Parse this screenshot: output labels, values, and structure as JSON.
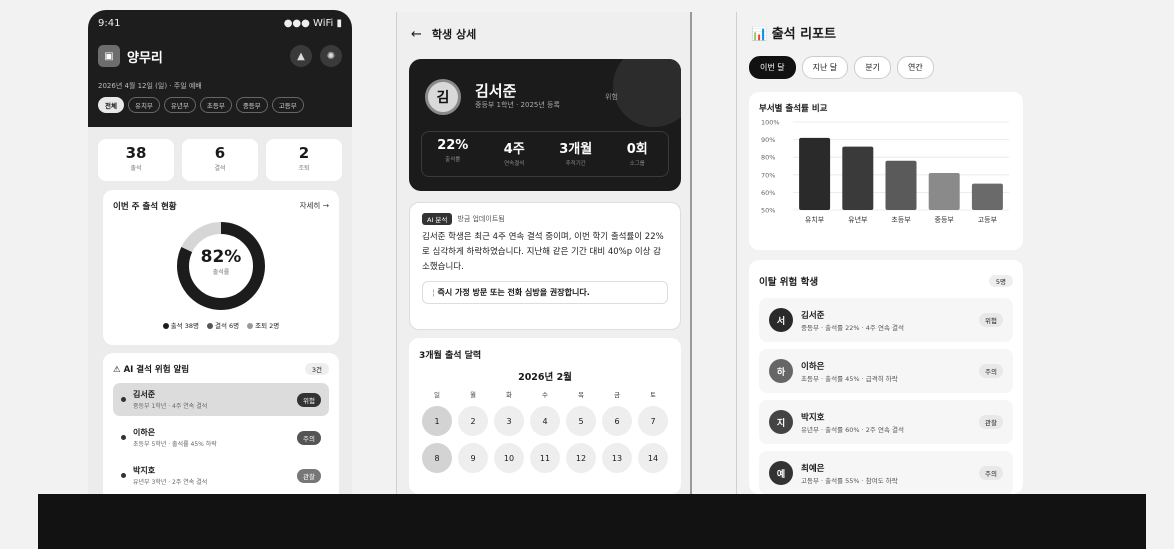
{
  "phone1": {
    "status": {
      "time": "9:41",
      "signal": "●●● WiFi ▮"
    },
    "app_name": "양무리",
    "date_line": "2026년 4월 12일 (일) · 주일 예배",
    "chips": [
      "전체",
      "유치부",
      "유년부",
      "초등부",
      "중등부",
      "고등부"
    ],
    "stats": [
      {
        "value": "38",
        "label": "출석"
      },
      {
        "value": "6",
        "label": "결석"
      },
      {
        "value": "2",
        "label": "조퇴"
      }
    ],
    "week": {
      "title": "이번 주 출석 현황",
      "more": "자세히 →",
      "percent": "82%",
      "percent_label": "출석률",
      "rate": 0.82,
      "legend": [
        "출석 38명",
        "결석 6명",
        "조퇴 2명"
      ]
    },
    "alerts": {
      "title": "⚠ AI 결석 위험 알림",
      "count": "3건",
      "items": [
        {
          "name": "김서준",
          "desc": "중등부 1학년 · 4주 연속 결석",
          "badge": "위험"
        },
        {
          "name": "이하은",
          "desc": "초등부 5학년 · 출석률 45% 하락",
          "badge": "주의"
        },
        {
          "name": "박지호",
          "desc": "유년부 3학년 · 2주 연속 결석",
          "badge": "관찰"
        }
      ]
    }
  },
  "phone2": {
    "back": "←",
    "title": "학생 상세",
    "profile": {
      "initial": "김",
      "name": "김서준",
      "sub": "중등부 1학년 · 2025년 등록",
      "risk": "위험",
      "stats": [
        {
          "value": "22%",
          "label": "출석률"
        },
        {
          "value": "4주",
          "label": "연속결석"
        },
        {
          "value": "3개월",
          "label": "추적기간"
        },
        {
          "value": "0회",
          "label": "소그룹"
        }
      ]
    },
    "ai": {
      "tag": "AI 분석",
      "updated": "방금 업데이트됨",
      "body": "김서준 학생은 최근 4주 연속 결석 중이며, 이번 학기 출석률이 22%로 심각하게 하락하였습니다. 지난해 같은 기간 대비 40%p 이상 감소했습니다.",
      "recommendation": "즉시 가정 방문 또는 전화 심방을 권장합니다."
    },
    "calendar": {
      "title": "3개월 출석 달력",
      "month": "2026년 2월",
      "dows": [
        "일",
        "월",
        "화",
        "수",
        "목",
        "금",
        "토"
      ],
      "days": [
        "1",
        "2",
        "3",
        "4",
        "5",
        "6",
        "7",
        "8",
        "9",
        "10",
        "11",
        "12",
        "13",
        "14"
      ]
    }
  },
  "phone3": {
    "title": "📊 출석 리포트",
    "tabs": [
      "이번 달",
      "지난 달",
      "분기",
      "연간"
    ],
    "bar_title": "부서별 출석률 비교",
    "risk_title": "이탈 위험 학생",
    "risk_count": "5명",
    "risk_items": [
      {
        "initial": "서",
        "name": "김서준",
        "desc": "중등부 · 출석률 22% · 4주 연속 결석",
        "badge": "위험"
      },
      {
        "initial": "하",
        "name": "이하은",
        "desc": "초등부 · 출석률 45% · 급격히 하락",
        "badge": "주의"
      },
      {
        "initial": "지",
        "name": "박지호",
        "desc": "유년부 · 출석률 60% · 2주 연속 결석",
        "badge": "관찰"
      },
      {
        "initial": "예",
        "name": "최예은",
        "desc": "고등부 · 출석률 55% · 참여도 하락",
        "badge": "주의"
      }
    ]
  },
  "chart_data": {
    "type": "bar",
    "categories": [
      "유치부",
      "유년부",
      "초등부",
      "중등부",
      "고등부"
    ],
    "values": [
      91,
      86,
      78,
      71,
      65
    ],
    "ylim": [
      50,
      100
    ],
    "yticks": [
      "50%",
      "60%",
      "70%",
      "80%",
      "90%",
      "100%"
    ],
    "colors": [
      "#2a2a2a",
      "#3a3a3a",
      "#5a5a5a",
      "#8a8a8a",
      "#6a6a6a"
    ],
    "grid": true
  }
}
